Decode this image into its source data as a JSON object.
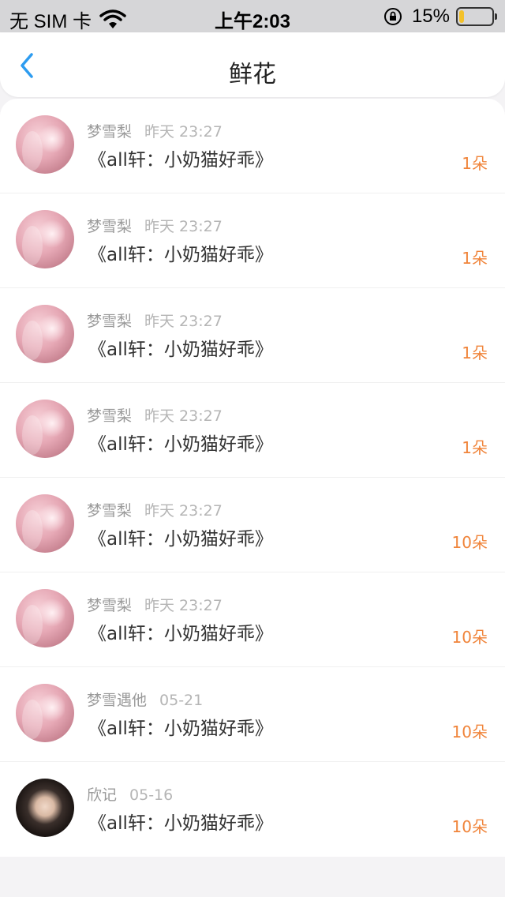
{
  "status_bar": {
    "carrier": "无 SIM 卡",
    "time": "上午2:03",
    "battery_text": "15%",
    "battery_level": 0.15
  },
  "nav": {
    "title": "鲜花"
  },
  "items": [
    {
      "name": "梦雪梨",
      "time": "昨天 23:27",
      "content": "《all轩：小奶猫好乖》",
      "count": "1朵",
      "avatar": "pink-avatar"
    },
    {
      "name": "梦雪梨",
      "time": "昨天 23:27",
      "content": "《all轩：小奶猫好乖》",
      "count": "1朵",
      "avatar": "pink-avatar"
    },
    {
      "name": "梦雪梨",
      "time": "昨天 23:27",
      "content": "《all轩：小奶猫好乖》",
      "count": "1朵",
      "avatar": "pink-avatar"
    },
    {
      "name": "梦雪梨",
      "time": "昨天 23:27",
      "content": "《all轩：小奶猫好乖》",
      "count": "1朵",
      "avatar": "pink-avatar"
    },
    {
      "name": "梦雪梨",
      "time": "昨天 23:27",
      "content": "《all轩：小奶猫好乖》",
      "count": "10朵",
      "avatar": "pink-avatar"
    },
    {
      "name": "梦雪梨",
      "time": "昨天 23:27",
      "content": "《all轩：小奶猫好乖》",
      "count": "10朵",
      "avatar": "pink-avatar"
    },
    {
      "name": "梦雪遇他",
      "time": "05-21",
      "content": "《all轩：小奶猫好乖》",
      "count": "10朵",
      "avatar": "pink-avatar"
    },
    {
      "name": "欣记",
      "time": "05-16",
      "content": "《all轩：小奶猫好乖》",
      "count": "10朵",
      "avatar": "dark-avatar"
    }
  ],
  "colors": {
    "accent": "#2d9cf0",
    "count": "#f0843a"
  }
}
